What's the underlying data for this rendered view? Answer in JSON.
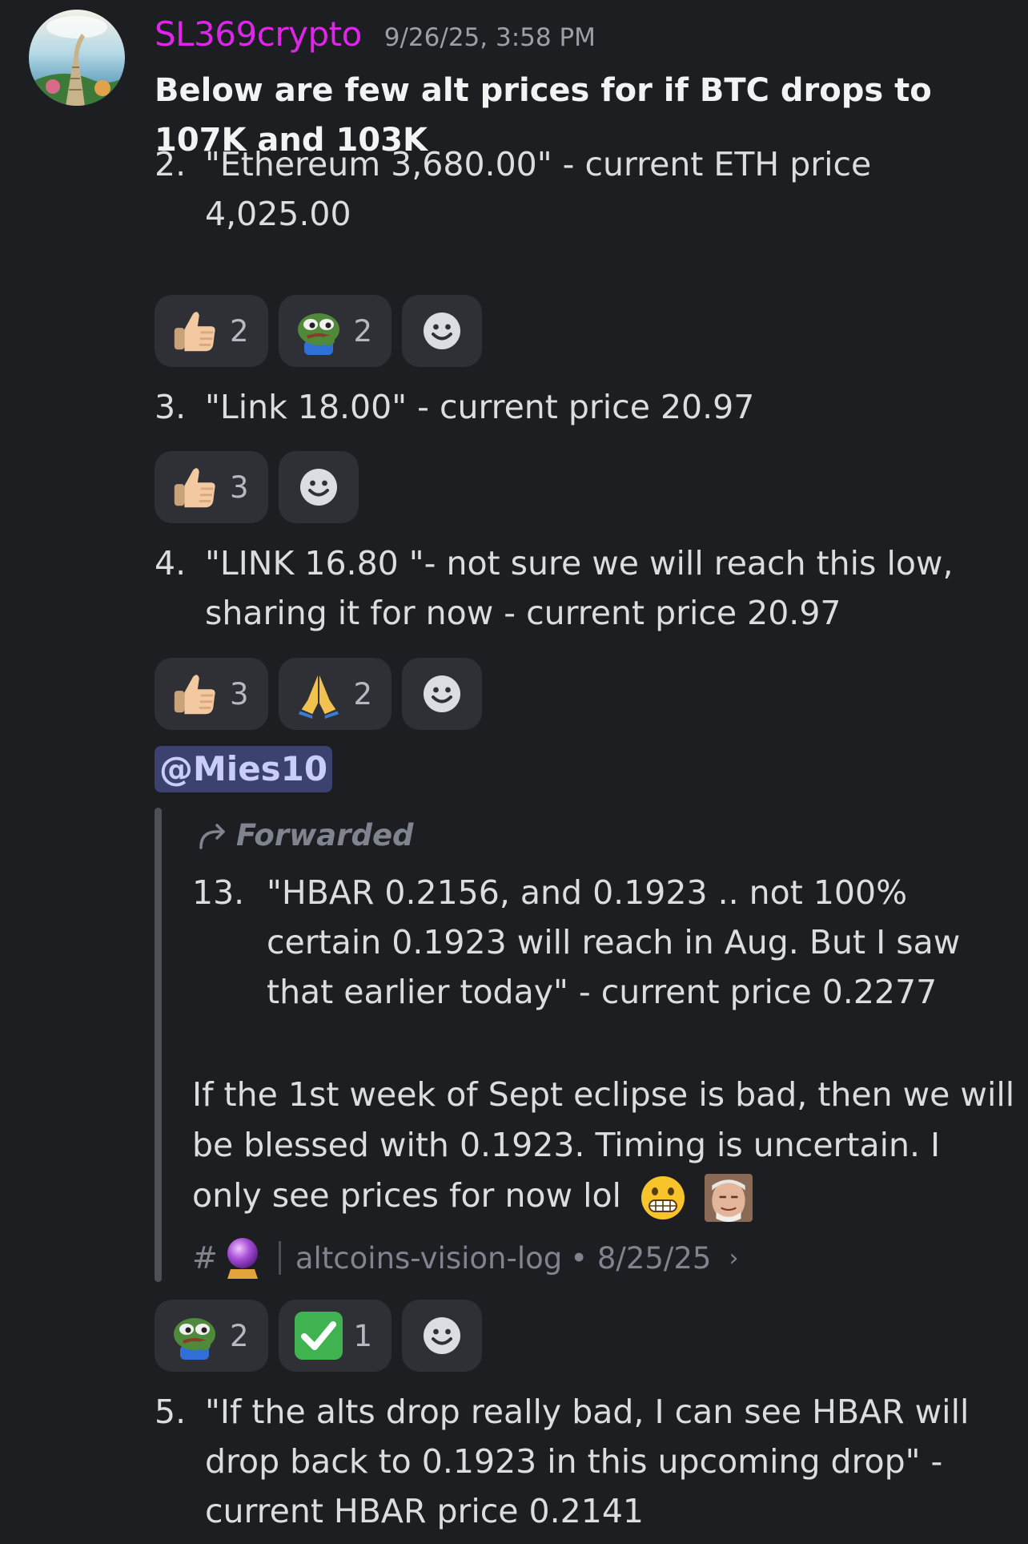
{
  "message": {
    "author": "SL369crypto",
    "timestamp": "9/26/25, 3:58 PM",
    "intro": "Below are few alt prices for if BTC drops to 107K and 103K",
    "items": [
      {
        "num": "2.",
        "text": "\"Ethereum 3,680.00\" - current ETH price 4,025.00"
      },
      {
        "num": "3.",
        "text": "\"Link 18.00\" - current price 20.97"
      },
      {
        "num": "4.",
        "text": "\"LINK 16.80 \"- not sure we will reach this low, sharing it for now - current price 20.97"
      },
      {
        "num": "5.",
        "text": "\"If the alts drop really bad, I can see HBAR will drop back to 0.1923 in this upcoming drop\" - current HBAR price 0.2141"
      }
    ],
    "reactions": {
      "r1": [
        {
          "emoji": "thumbs-up",
          "count": "2"
        },
        {
          "emoji": "pepe-frog",
          "count": "2"
        }
      ],
      "r2": [
        {
          "emoji": "thumbs-up",
          "count": "3"
        }
      ],
      "r3": [
        {
          "emoji": "thumbs-up",
          "count": "3"
        },
        {
          "emoji": "folded-hands",
          "count": "2"
        }
      ],
      "r4": [
        {
          "emoji": "pepe-frog",
          "count": "2"
        },
        {
          "emoji": "check-mark",
          "count": "1"
        }
      ]
    },
    "mention": "@Mies10",
    "forwarded": {
      "label": "Forwarded",
      "item": {
        "num": "13.",
        "text": "\"HBAR 0.2156, and 0.1923 .. not 100% certain 0.1923 will reach in Aug. But I saw that earlier today\" - current price 0.2277"
      },
      "paragraph": "If the 1st week of Sept eclipse is bad, then we will be blessed with 0.1923.  Timing is uncertain. I only see prices for now lol",
      "source": {
        "hash": "#",
        "channel": "altcoins-vision-log",
        "date": "• 8/25/25"
      }
    }
  }
}
